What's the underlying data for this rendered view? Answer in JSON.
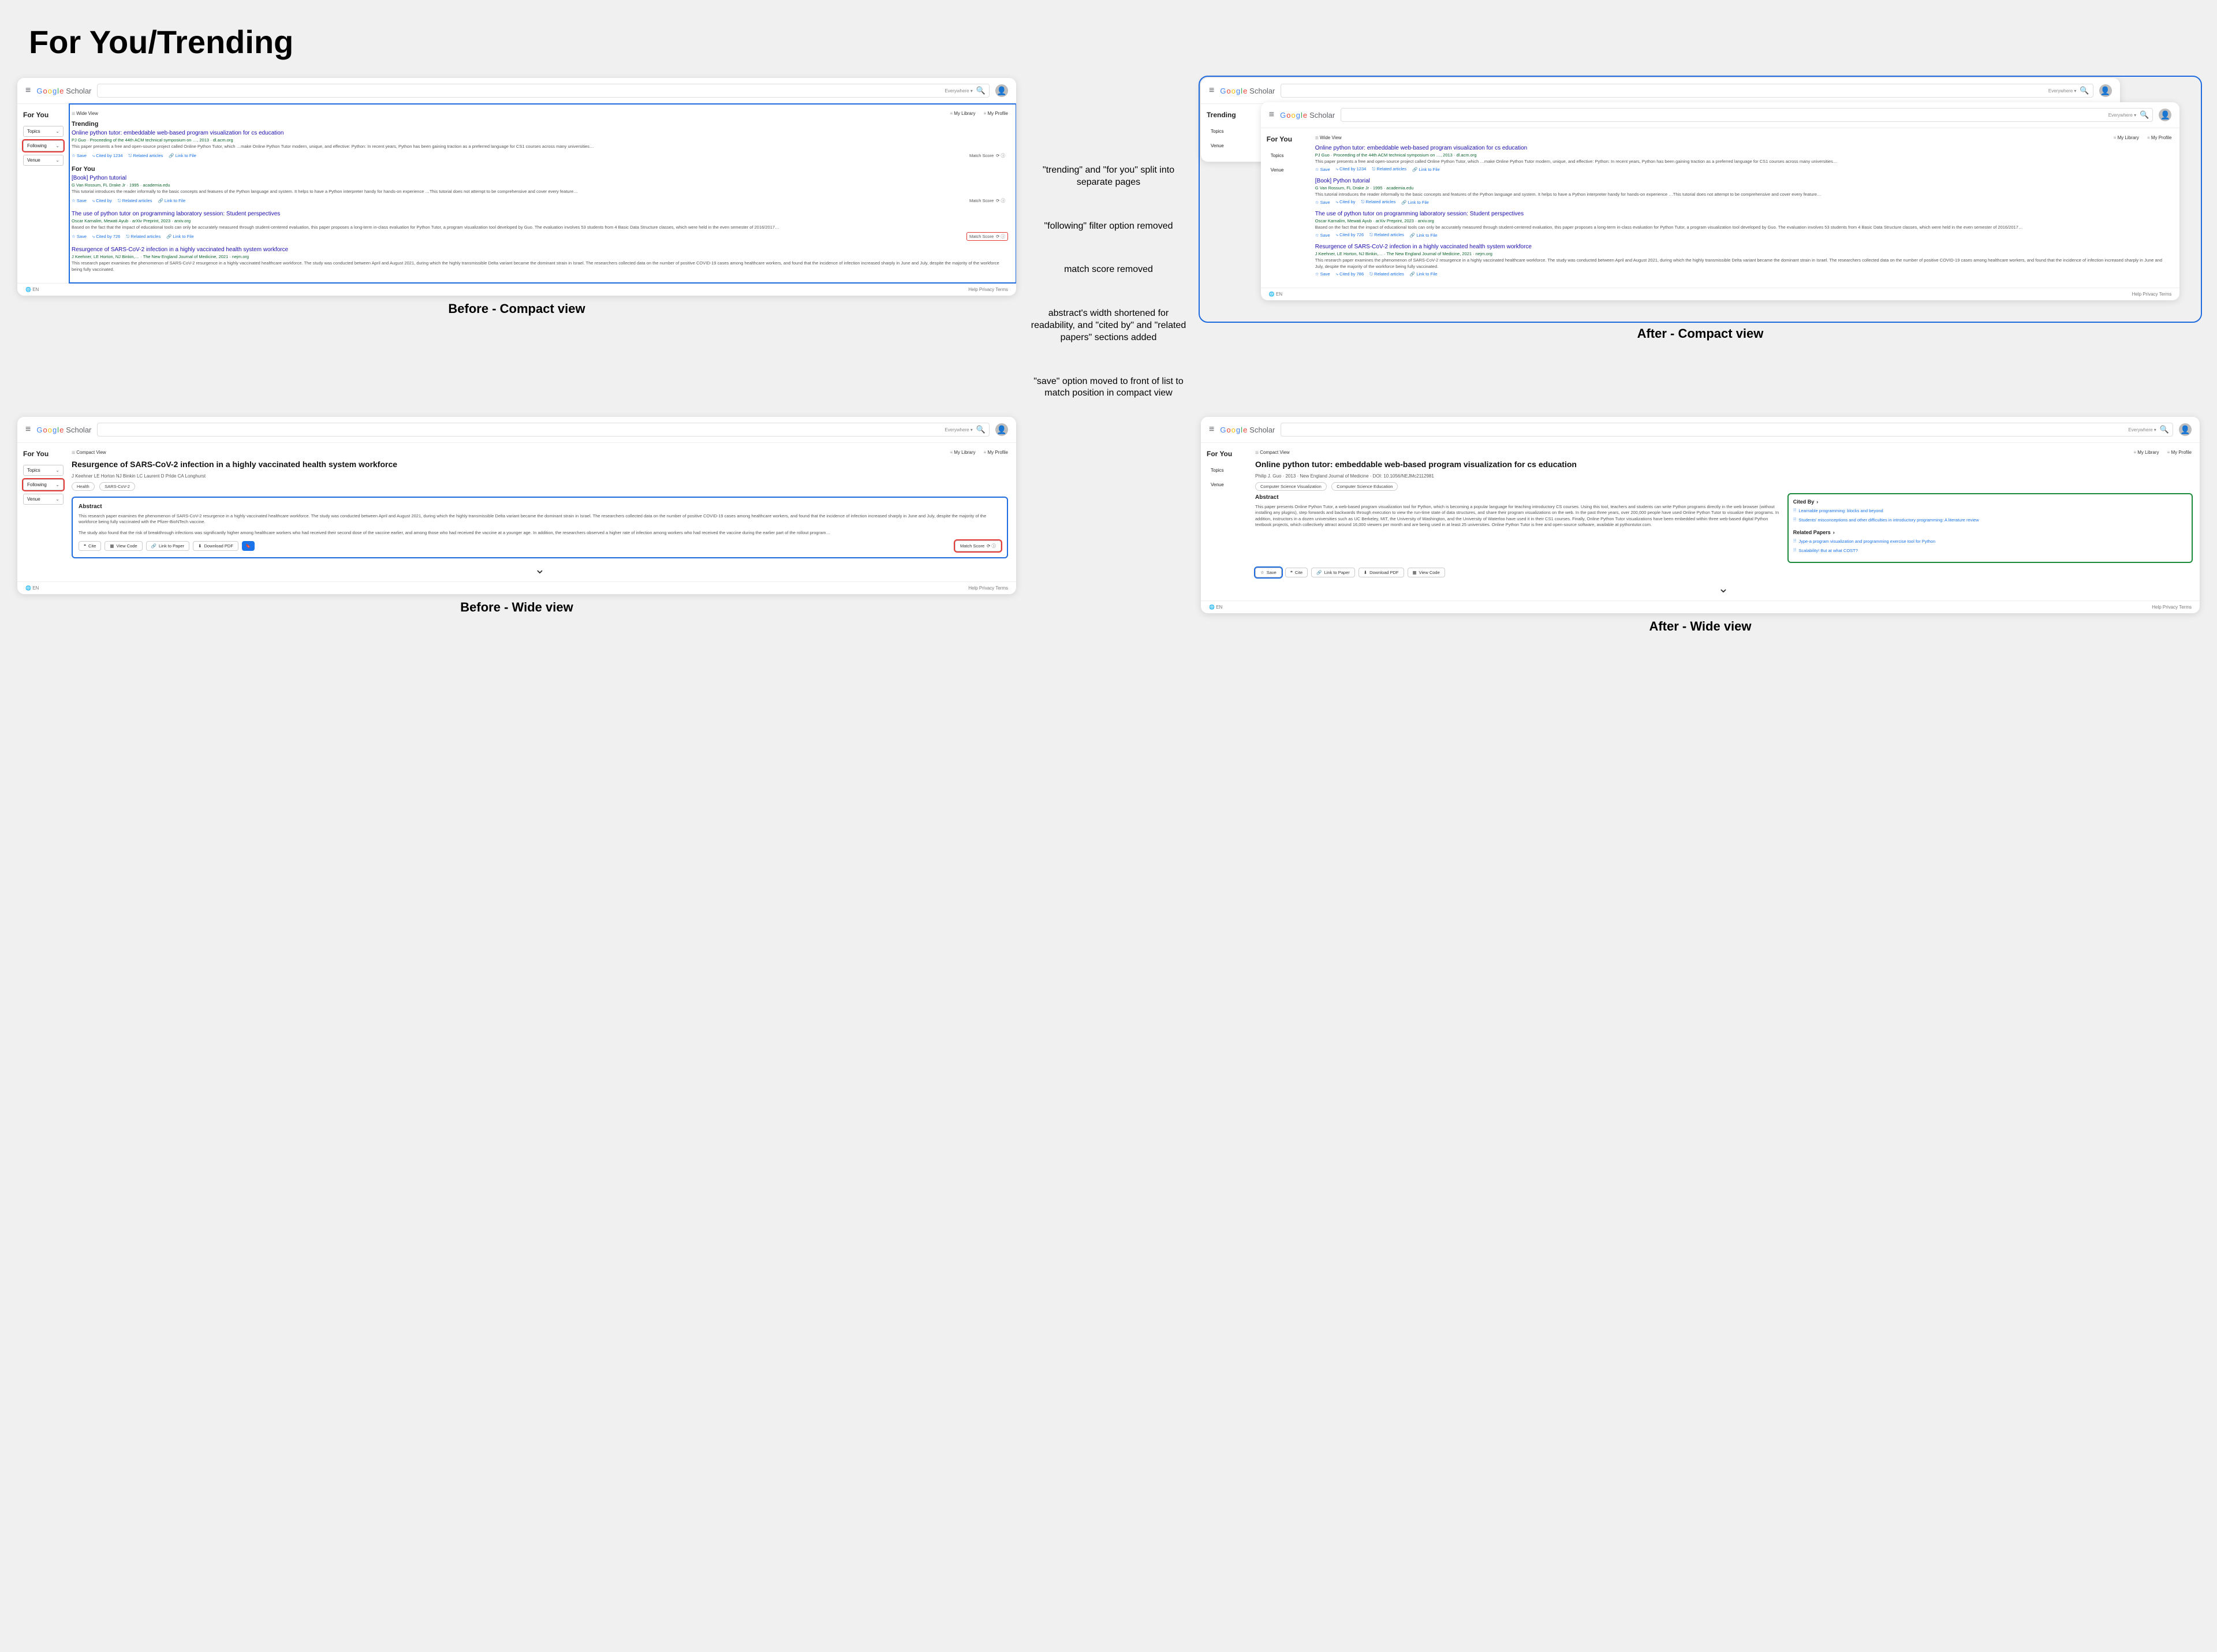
{
  "title": "For You/Trending",
  "captions": {
    "beforeCompact": "Before - Compact view",
    "afterCompact": "After - Compact view",
    "beforeWide": "Before - Wide view",
    "afterWide": "After - Wide view"
  },
  "annotations": {
    "split": "\"trending\" and \"for you\" split into separate pages",
    "following": "\"following\" filter option removed",
    "matchscore": "match score removed",
    "abstract": "abstract's width shortened for readability, and \"cited by\" and \"related papers\" sections added",
    "save": "\"save\" option moved to front of list to match position in compact view"
  },
  "ui": {
    "logoScholar": "Scholar",
    "searchScope": "Everywhere ▾",
    "sidebar": {
      "forYou": "For You",
      "trending": "Trending",
      "topics": "Topics",
      "following": "Following",
      "venue": "Venue"
    },
    "viewToggle": {
      "wide": "Wide View",
      "compact": "Compact View"
    },
    "headerLinks": {
      "library": "My Library",
      "profile": "My Profile"
    },
    "sectionTrending": "Trending",
    "sectionForYou": "For You",
    "actions": {
      "save": "Save",
      "citedBy": "Cited by",
      "related": "Related articles",
      "linkFile": "Link to File",
      "matchScore": "Match Score",
      "cite": "Cite",
      "viewCode": "View Code",
      "linkPaper": "Link to Paper",
      "downloadPdf": "Download PDF"
    },
    "abstractLabel": "Abstract",
    "citedByPanel": "Cited By",
    "relatedPanel": "Related Papers",
    "footerLang": "EN",
    "footerLinks": "Help  Privacy  Terms"
  },
  "results": [
    {
      "title": "Online python tutor: embeddable web-based program visualization for cs education",
      "meta": "PJ Guo · Proceeding of the 44th ACM technical symposium on …, 2013 · dl.acm.org",
      "metaShort": "Philip J. Guo · 2013 · New England Journal of Medicine · DOI: 10.1056/NEJMc2112981",
      "citedNum": "1234",
      "snippet": "This paper presents a free and open-source project called Online Python Tutor, which …make Online Python Tutor modern, unique, and effective: Python: In recent years, Python has been gaining traction as a preferred language for CS1 courses across many universities…"
    },
    {
      "title": "[Book] Python tutorial",
      "meta": "G Van Rossum, FL Drake Jr · 1995 · academia.edu",
      "citedNum": "—",
      "snippet": "This tutorial introduces the reader informally to the basic concepts and features of the Python language and system. It helps to have a Python interpreter handy for hands-on experience …This tutorial does not attempt to be comprehensive and cover every feature…"
    },
    {
      "title": "The use of python tutor on programming laboratory session: Student perspectives",
      "meta": "Oscar Karnalim, Mewati Ayub · arXiv Preprint, 2023 · arxiv.org",
      "citedNum": "726",
      "snippet": "Based on the fact that the impact of educational tools can only be accurately measured through student-centered evaluation, this paper proposes a long-term in-class evaluation for Python Tutor, a program visualization tool developed by Guo. The evaluation involves 53 students from 4 Basic Data Structure classes, which were held in the even semester of 2016/2017…"
    },
    {
      "title": "Resurgence of SARS-CoV-2 infection in a highly vaccinated health system workforce",
      "meta": "J Keehner, LE Horton, NJ Binkin,… · The New England Journal of Medicine, 2021 · nejm.org",
      "citedNum": "786",
      "snippet": "This research paper examines the phenomenon of SARS-CoV-2 resurgence in a highly vaccinated healthcare workforce. The study was conducted between April and August 2021, during which the highly transmissible Delta variant became the dominant strain in Israel. The researchers collected data on the number of positive COVID-19 cases among healthcare workers, and found that the incidence of infection increased sharply in June and July, despite the majority of the workforce being fully vaccinated."
    }
  ],
  "wideBefore": {
    "authors": "J Keehner   LE Horton   NJ Binkin   LC Laurent   D Pride   CA Longhurst",
    "tags": [
      "Health",
      "SARS-CoV-2"
    ],
    "abstract1": "This research paper examines the phenomenon of SARS-CoV-2 resurgence in a highly vaccinated healthcare workforce. The study was conducted between April and August 2021, during which the highly transmissible Delta variant became the dominant strain in Israel. The researchers collected data on the number of positive COVID-19 cases among healthcare workers, and found that the incidence of infection increased sharply in June and July, despite the majority of the workforce being fully vaccinated with the Pfizer-BioNTech vaccine.",
    "abstract2": "The study also found that the risk of breakthrough infections was significantly higher among healthcare workers who had received their second dose of the vaccine earlier, and among those who had received the vaccine at a younger age. In addition, the researchers observed a higher rate of infection among workers who had received the vaccine during the earlier part of the rollout program…"
  },
  "wideAfter": {
    "tags": [
      "Computer Science Visualization",
      "Computer Science Education"
    ],
    "abstract": "This paper presents Online Python Tutor, a web-based program visualization tool for Python, which is becoming a popular language for teaching introductory CS courses. Using this tool, teachers and students can write Python programs directly in the web browser (without installing any plugins), step forwards and backwards through execution to view the run-time state of data structures, and share their program visualizations on the web. In the past three years, over 200,000 people have used Online Python Tutor to visualize their programs. In addition, instructors in a dozen universities such as UC Berkeley, MIT, the University of Washington, and the University of Waterloo have used it in their CS1 courses. Finally, Online Python Tutor visualizations have been embedded within three web-based digital Python textbook projects, which collectively attract around 16,000 viewers per month and are being used in at least 25 universities. Online Python Tutor is free and open-source software, available at pythontutor.com.",
    "citedBy": [
      "Learnable programming: blocks and beyond",
      "Students' misconceptions and other difficulties in introductory programming: A literature review"
    ],
    "related": [
      "Jype-a program visualization and programming exercise tool for Python",
      "Scalability! But at what COST?"
    ]
  }
}
